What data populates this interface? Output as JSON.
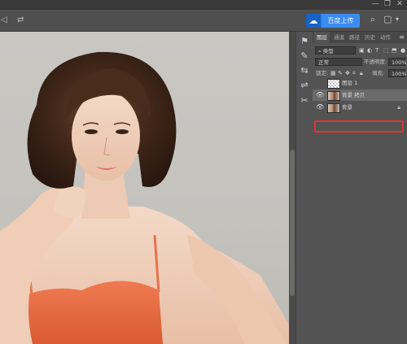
{
  "window": {
    "controls": [
      "—",
      "❐",
      "✕"
    ]
  },
  "options_bar": {
    "left_glyphs": [
      "◁",
      "⇄"
    ],
    "upload_button": {
      "icon": "baidu-cloud-icon",
      "label": "百度上传"
    },
    "right_icons": [
      "search-icon",
      "workspace-icon"
    ]
  },
  "panel": {
    "tabs": [
      "图层",
      "通道",
      "路径",
      "历史",
      "动作"
    ],
    "kind_filter": {
      "icon": "search-icon",
      "value": "类型"
    },
    "filter_icons": [
      "image-filter-icon",
      "adjust-filter-icon",
      "type-filter-icon",
      "shape-filter-icon",
      "smart-filter-icon"
    ],
    "blend_mode": "正常",
    "opacity": {
      "label": "不透明度:",
      "value": "100%"
    },
    "lock": {
      "label": "锁定:",
      "icons": [
        "lock-pixels-icon",
        "lock-paint-icon",
        "lock-position-icon",
        "lock-artboard-icon",
        "lock-all-icon"
      ]
    },
    "fill": {
      "label": "填充:",
      "value": "100%"
    },
    "layers": [
      {
        "name": "图层 1",
        "visible": false,
        "thumb": "transparent",
        "locked": false,
        "selected": false
      },
      {
        "name": "背景 拷贝",
        "visible": true,
        "thumb": "photo",
        "locked": false,
        "selected": true
      },
      {
        "name": "背景",
        "visible": true,
        "thumb": "photo",
        "locked": true,
        "selected": false
      }
    ]
  },
  "toolstrip": [
    "history-icon",
    "brush-settings-icon",
    "properties-icon",
    "adjustments-icon",
    "gradient-icon"
  ],
  "colors": {
    "accent": "#2f7fe0",
    "selection_outline": "#e0332f",
    "panel_bg": "#535353"
  }
}
